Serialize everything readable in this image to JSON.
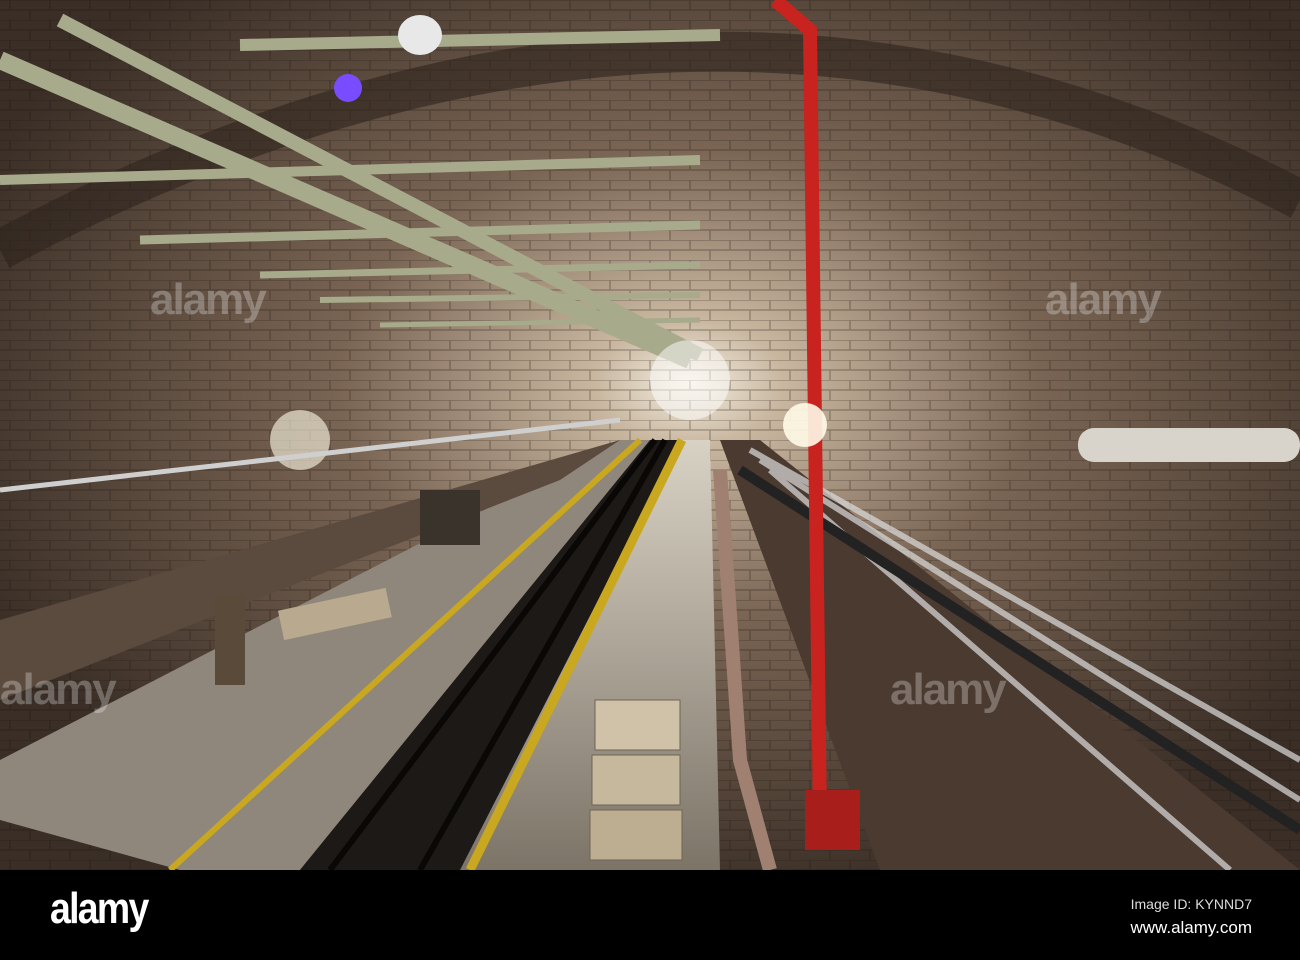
{
  "photo": {
    "subject": "brick arched railway tunnel with tracks",
    "watermark_text": "alamy"
  },
  "footer": {
    "logo": "alamy",
    "image_id": "Image ID: KYNND7",
    "website": "www.alamy.com"
  },
  "colors": {
    "brick": "#6e5444",
    "pipe_red": "#c8231e",
    "track_yellow": "#c9a820",
    "beam": "#a8aa8c"
  }
}
